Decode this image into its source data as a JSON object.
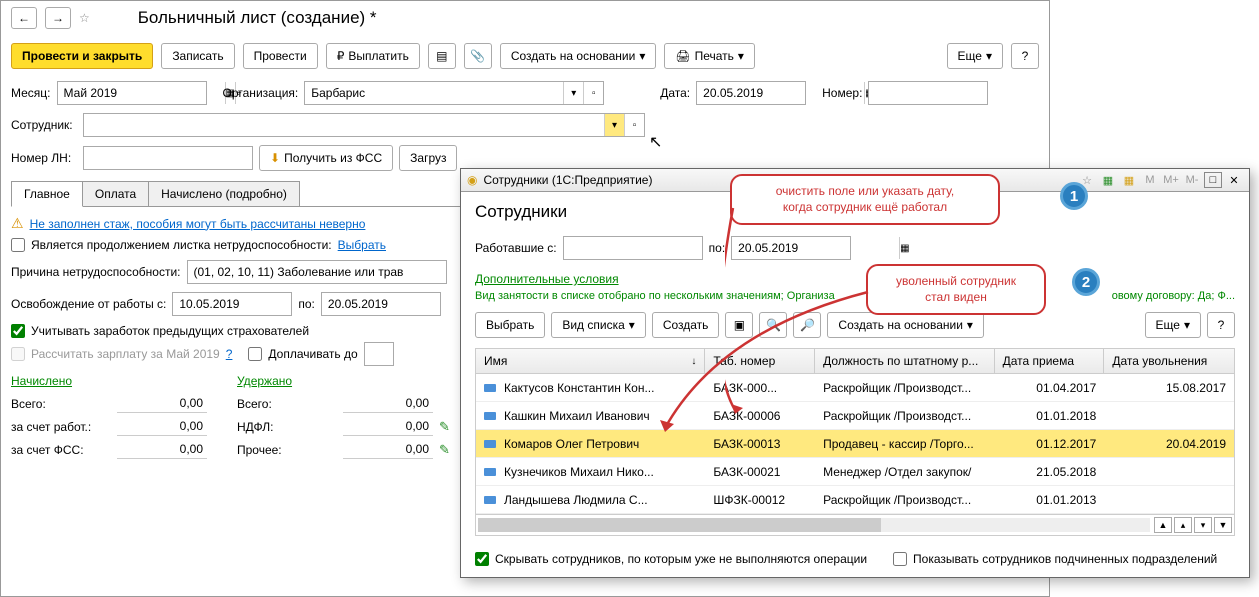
{
  "main": {
    "title": "Больничный лист (создание) *",
    "toolbar": {
      "post_close": "Провести и закрыть",
      "save": "Записать",
      "post": "Провести",
      "pay": "Выплатить",
      "create_based": "Создать на основании",
      "print": "Печать",
      "more": "Еще",
      "help": "?"
    },
    "month_label": "Месяц:",
    "month_value": "Май 2019",
    "org_label": "Организация:",
    "org_value": "Барбарис",
    "date_label": "Дата:",
    "date_value": "20.05.2019",
    "number_label": "Номер:",
    "employee_label": "Сотрудник:",
    "ln_label": "Номер ЛН:",
    "get_fss": "Получить из ФСС",
    "load": "Загруз",
    "tabs": [
      "Главное",
      "Оплата",
      "Начислено (подробно)"
    ],
    "warning": "Не заполнен стаж, пособия могут быть рассчитаны неверно",
    "continuation": "Является продолжением листка нетрудоспособности:",
    "choose": "Выбрать",
    "reason_label": "Причина нетрудоспособности:",
    "reason_value": "(01, 02, 10, 11) Заболевание или трав",
    "release_label": "Освобождение от работы с:",
    "release_from": "10.05.2019",
    "release_to_label": "по:",
    "release_to": "20.05.2019",
    "prev_insurers": "Учитывать заработок предыдущих страхователей",
    "calc_salary": "Рассчитать зарплату за Май 2019",
    "pay_extra": "Доплачивать до",
    "accrued_header": "Начислено",
    "withheld_header": "Удержано",
    "totals": {
      "total": "Всего:",
      "employer": "за счет работ.:",
      "fss": "за счет ФСС:",
      "ndfl": "НДФЛ:",
      "other": "Прочее:",
      "zero": "0,00"
    }
  },
  "dialog": {
    "title": "Сотрудники (1С:Предприятие)",
    "heading": "Сотрудники",
    "worked_from_label": "Работавшие с:",
    "worked_to_label": "по:",
    "worked_to": "20.05.2019",
    "conditions_header": "Дополнительные условия",
    "conditions_text": "Вид занятости в списке отобрано по нескольким значениям; Организа",
    "conditions_tail": "овому договору: Да; Ф...",
    "toolbar": {
      "select": "Выбрать",
      "view": "Вид списка",
      "create": "Создать",
      "create_based": "Создать на основании",
      "more": "Еще",
      "help": "?"
    },
    "columns": {
      "name": "Имя",
      "tab_no": "Таб. номер",
      "position": "Должность по штатному р...",
      "hire_date": "Дата приема",
      "fire_date": "Дата увольнения"
    },
    "rows": [
      {
        "name": "Кактусов Константин Кон...",
        "tab": "БАЗК-000...",
        "pos": "Раскройщик /Производст...",
        "hire": "01.04.2017",
        "fire": "15.08.2017",
        "sel": false
      },
      {
        "name": "Кашкин Михаил Иванович",
        "tab": "БАЗК-00006",
        "pos": "Раскройщик /Производст...",
        "hire": "01.01.2018",
        "fire": "",
        "sel": false
      },
      {
        "name": "Комаров Олег Петрович",
        "tab": "БАЗК-00013",
        "pos": "Продавец - кассир /Торго...",
        "hire": "01.12.2017",
        "fire": "20.04.2019",
        "sel": true
      },
      {
        "name": "Кузнечиков Михаил Нико...",
        "tab": "БАЗК-00021",
        "pos": "Менеджер /Отдел закупок/",
        "hire": "21.05.2018",
        "fire": "",
        "sel": false
      },
      {
        "name": "Ландышева Людмила С...",
        "tab": "ШФЗК-00012",
        "pos": "Раскройщик /Производст...",
        "hire": "01.01.2013",
        "fire": "",
        "sel": false
      }
    ],
    "hide_employees": "Скрывать сотрудников, по которым уже не выполняются операции",
    "show_sub": "Показывать сотрудников подчиненных подразделений"
  },
  "callouts": {
    "c1": "очистить поле или указать дату,\nкогда сотрудник ещё работал",
    "c2": "уволенный сотрудник\nстал виден"
  }
}
